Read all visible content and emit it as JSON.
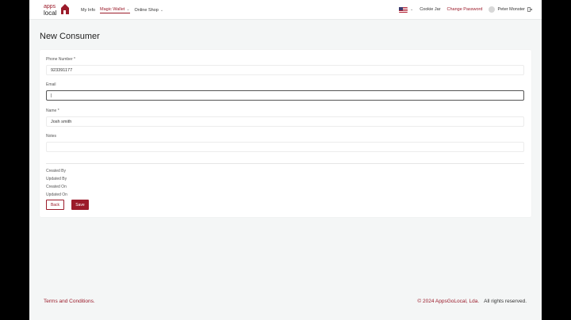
{
  "brand": {
    "logo_text_top": "apps",
    "logo_text_bottom": "local",
    "accent": "#9b1b2a"
  },
  "nav": {
    "items": [
      {
        "label": "My Info",
        "dropdown": false,
        "active": false
      },
      {
        "label": "Magic Wallet",
        "dropdown": true,
        "active": true
      },
      {
        "label": "Online Shop",
        "dropdown": true,
        "active": false
      }
    ]
  },
  "header_right": {
    "flag_icon": "us-flag-icon",
    "store": "Cookie Jar",
    "change_password": "Change Password",
    "user": "Peter Monster",
    "logout_icon": "logout-icon"
  },
  "page": {
    "title": "New Consumer"
  },
  "form": {
    "phone": {
      "label": "Phone Number *",
      "value": "923391177"
    },
    "email": {
      "label": "Email",
      "value": ""
    },
    "name": {
      "label": "Name *",
      "value": "Josh smith"
    },
    "notes": {
      "label": "Notes",
      "value": ""
    }
  },
  "meta": {
    "created_by": "Created By",
    "updated_by": "Updated By",
    "created_on": "Created On",
    "updated_on": "Updated On"
  },
  "buttons": {
    "back": "Back",
    "save": "Save"
  },
  "footer": {
    "terms": "Terms and Conditions.",
    "copyright": "© 2024 AppsGoLocal, Lda.",
    "rights": "All rights reserved."
  }
}
